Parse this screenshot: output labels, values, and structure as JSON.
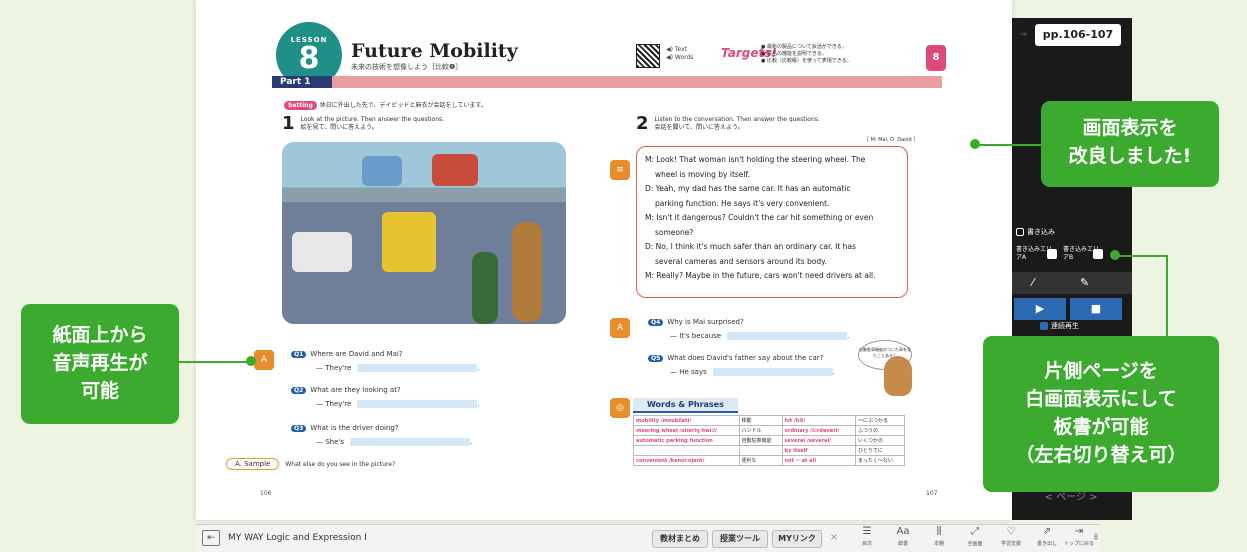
{
  "lesson": {
    "label": "LESSON",
    "number": "8",
    "title": "Future Mobility",
    "subtitle": "未来の技術を想像しよう［比較❶］",
    "part": "Part 1",
    "qr_text": "◀) Text\n◀) Words",
    "targets_label": "Targets!",
    "targets": "● 最新の製品について会話ができる。\n● 製品の機能を説明できる。\n● 比較（比較級）を使って表現できる。",
    "page_tab": "8"
  },
  "left_page": {
    "setting_badge": "Setting",
    "setting_text": "休日に外出した先で、デイビッドと麻衣が会話をしています。",
    "q1_number": "1",
    "q1_text": "Look at the picture. Then answer the questions.",
    "q1_jp": "絵を見て、問いに答えよう。",
    "questions": [
      {
        "tag": "Q1",
        "q": "Where are David and Mai?",
        "a": "— They're"
      },
      {
        "tag": "Q2",
        "q": "What are they looking at?",
        "a": "— They're"
      },
      {
        "tag": "Q3",
        "q": "What is the driver doing?",
        "a": "— She's"
      }
    ],
    "sample_label": "A. Sample",
    "sample_text": "What else do you see in the picture?",
    "page_no": "106"
  },
  "right_page": {
    "q2_number": "2",
    "q2_text": "Listen to the conversation. Then answer the questions.",
    "q2_jp": "会話を聞いて、問いに答えよう。",
    "speakers": "［ M: Mai, D: David ］",
    "dialog": [
      "M: Look!  That woman isn't holding the steering wheel.  The",
      "wheel is moving by itself.",
      "D: Yeah, my dad has the same car.  It has an automatic",
      "parking function.  He says it's very convenient.",
      "M: Isn't it dangerous?  Couldn't the car hit something or even",
      "someone?",
      "D: No, I think it's much safer than an ordinary car.  It has",
      "several cameras and sensors around its body.",
      "M: Really?  Maybe in the future, cars won't need drivers at all."
    ],
    "questions": [
      {
        "tag": "Q4",
        "q": "Why is Mai surprised?",
        "a": "— It's because"
      },
      {
        "tag": "Q5",
        "q": "What does David's father say about the car?",
        "a": "— He says"
      }
    ],
    "bubble_text": "自動駐車機能のついた車を見たことある？",
    "words_header": "Words & Phrases",
    "words": [
      [
        "mobility /moubíləti/",
        "移動",
        "hit /hít/",
        "～にぶつかる"
      ],
      [
        "steering wheel /stíəriŋ hwì:l/",
        "ハンドル",
        "ordinary /ɔ́:rdənèri/",
        "ふつうの"
      ],
      [
        "automatic parking function",
        "自動駐車機能",
        "several /sévərəl/",
        "いくつかの"
      ],
      [
        "",
        "",
        "by itself",
        "ひとりでに"
      ],
      [
        "convenient /kənví:njənt/",
        "便利な",
        "not ~ at all",
        "まったく～ない"
      ]
    ],
    "page_no": "107"
  },
  "sidebar": {
    "page_range": "pp.106-107",
    "write_label": "書き込み",
    "area_a": "書き込みエリアA",
    "area_b": "書き込みエリアB",
    "continuous_play": "連続再生",
    "page_nav": "< ページ >"
  },
  "callouts": {
    "left": "紙面上から\n音声再生が\n可能",
    "top_right": "画面表示を\n改良しました!",
    "bottom_right": "片側ページを\n白画面表示にして\n板書が可能\n（左右切り替え可）"
  },
  "bottom_bar": {
    "app_title": "MY WAY Logic and Expression I",
    "buttons": [
      "教材まとめ",
      "授業ツール",
      "MYリンク"
    ],
    "close": "×",
    "tools": [
      {
        "icon": "目次",
        "label": "目次"
      },
      {
        "icon": "辞書",
        "label": "辞書"
      },
      {
        "icon": "本棚",
        "label": "本棚"
      },
      {
        "icon": "全画面",
        "label": "全画面"
      },
      {
        "icon": "学習支援",
        "label": "学習支援"
      },
      {
        "icon": "書き出し",
        "label": "書き出し"
      },
      {
        "icon": "トップに戻る",
        "label": "トップに戻る"
      }
    ]
  },
  "colors": {
    "accent_green": "#3caa2f",
    "lesson_teal": "#1f8f88",
    "accent_pink": "#e1487d"
  }
}
